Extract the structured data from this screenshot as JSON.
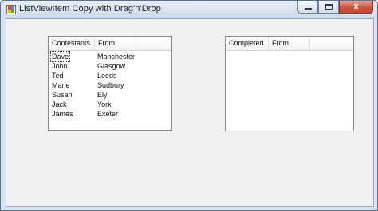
{
  "window": {
    "title": "ListViewItem Copy with Drag'n'Drop",
    "close_glyph": "x"
  },
  "left_list": {
    "columns": [
      "Contestants",
      "From",
      ""
    ],
    "rows": [
      [
        "Dave",
        "Manchester"
      ],
      [
        "John",
        "Glasgow"
      ],
      [
        "Ted",
        "Leeds"
      ],
      [
        "Marie",
        "Sudbury"
      ],
      [
        "Susan",
        "Ely"
      ],
      [
        "Jack",
        "York"
      ],
      [
        "James",
        "Exeter"
      ]
    ]
  },
  "right_list": {
    "columns": [
      "Completed",
      "From",
      ""
    ],
    "rows": []
  },
  "colors": {
    "border": "#828790",
    "close_button": "#c9503a",
    "client_bg": "#f0f0f0"
  },
  "icons": [
    "app-icon",
    "minimize-icon",
    "maximize-icon",
    "close-icon"
  ]
}
